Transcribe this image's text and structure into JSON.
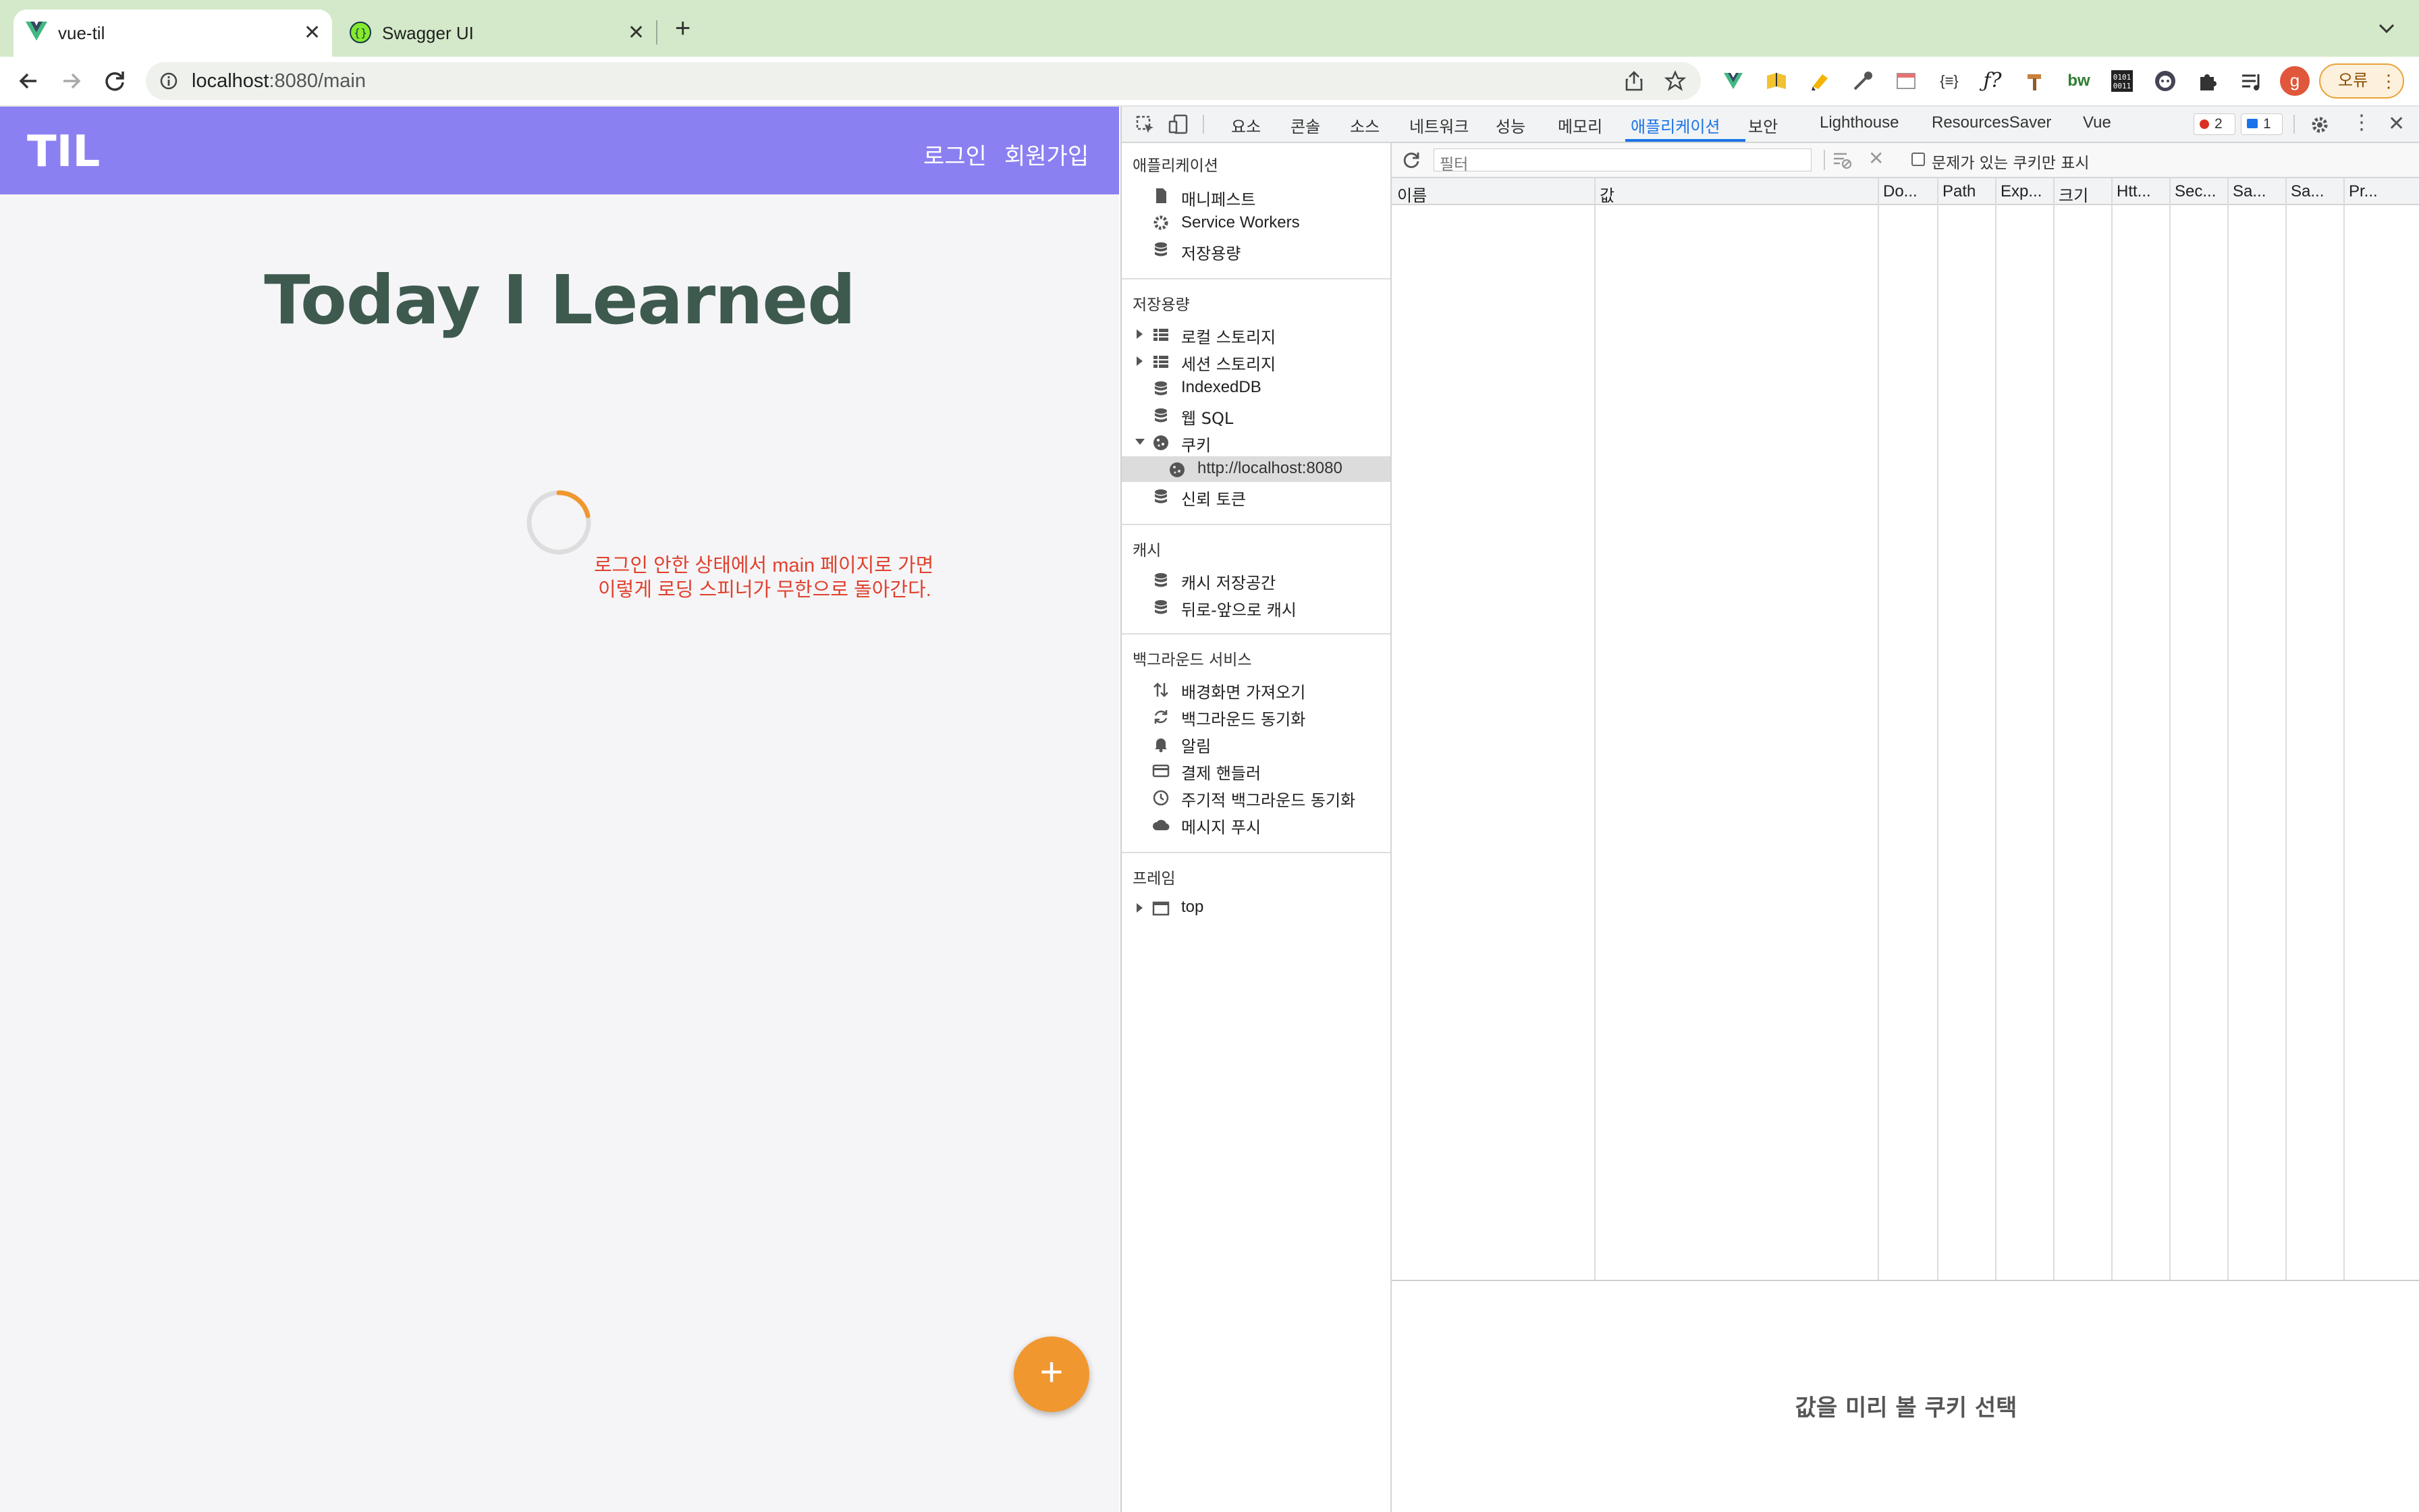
{
  "browser": {
    "tabs": [
      {
        "title": "vue-til",
        "active": true,
        "favicon": "vue-logo-icon"
      },
      {
        "title": "Swagger UI",
        "active": false,
        "favicon": "swagger-logo-icon"
      }
    ],
    "url_host": "localhost",
    "url_rest": ":8080/main",
    "profile_initial": "g",
    "error_button": "오류",
    "colors": {
      "tabstrip": "#d3e9c9",
      "error_border": "#e9a23b"
    }
  },
  "page": {
    "logo": "TIL",
    "nav": {
      "login": "로그인",
      "signup": "회원가입"
    },
    "title": "Today I Learned",
    "annotation": [
      "로그인 안한 상태에서 main 페이지로 가면",
      "이렇게 로딩 스피너가 무한으로 돌아간다."
    ],
    "fab_label": "+",
    "colors": {
      "header": "#8b80f1",
      "title": "#3e5a4f",
      "spinner": "#f0972f",
      "fab": "#f0972f",
      "annotation": "#e0412e"
    }
  },
  "devtools": {
    "tabs": [
      "요소",
      "콘솔",
      "소스",
      "네트워크",
      "성능",
      "메모리",
      "애플리케이션",
      "보안",
      "Lighthouse",
      "ResourcesSaver",
      "Vue"
    ],
    "active_tab": "애플리케이션",
    "error_count": "2",
    "message_count": "1",
    "sidebar": {
      "app_section": "애플리케이션",
      "app_items": [
        "매니페스트",
        "Service Workers",
        "저장용량"
      ],
      "storage_section": "저장용량",
      "storage_items": [
        "로컬 스토리지",
        "세션 스토리지",
        "IndexedDB",
        "웹 SQL",
        "쿠키",
        "http://localhost:8080",
        "신뢰 토큰"
      ],
      "cache_section": "캐시",
      "cache_items": [
        "캐시 저장공간",
        "뒤로-앞으로 캐시"
      ],
      "bg_section": "백그라운드 서비스",
      "bg_items": [
        "배경화면 가져오기",
        "백그라운드 동기화",
        "알림",
        "결제 핸들러",
        "주기적 백그라운드 동기화",
        "메시지 푸시"
      ],
      "frames_section": "프레임",
      "frames_items": [
        "top"
      ]
    },
    "cookies": {
      "filter_placeholder": "필터",
      "only_issues_label": "문제가 있는 쿠키만 표시",
      "columns": [
        "이름",
        "값",
        "Do...",
        "Path",
        "Exp...",
        "크기",
        "Htt...",
        "Sec...",
        "Sa...",
        "Sa...",
        "Pr..."
      ],
      "preview_message": "값을 미리 볼 쿠키 선택"
    }
  }
}
